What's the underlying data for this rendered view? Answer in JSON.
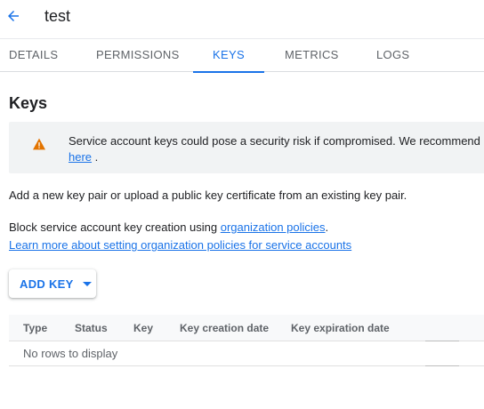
{
  "header": {
    "title": "test",
    "back_icon": "arrow-back-icon"
  },
  "tabs": [
    {
      "label": "DETAILS",
      "active": false
    },
    {
      "label": "PERMISSIONS",
      "active": false
    },
    {
      "label": "KEYS",
      "active": true
    },
    {
      "label": "METRICS",
      "active": false
    },
    {
      "label": "LOGS",
      "active": false
    }
  ],
  "keys_section": {
    "title": "Keys",
    "warning": {
      "icon": "warning-icon",
      "text": "Service account keys could pose a security risk if compromised. We recommend",
      "link_text": "here",
      "link_suffix": " ."
    },
    "intro": "Add a new key pair or upload a public key certificate from an existing key pair.",
    "block_text": "Block service account key creation using ",
    "block_link": "organization policies",
    "block_suffix": ".",
    "learn_more_link": "Learn more about setting organization policies for service accounts",
    "add_key_label": "ADD KEY"
  },
  "table": {
    "columns": [
      "Type",
      "Status",
      "Key",
      "Key creation date",
      "Key expiration date"
    ],
    "empty_message": "No rows to display"
  },
  "colors": {
    "accent": "#1a73e8",
    "warning": "#e37400"
  }
}
